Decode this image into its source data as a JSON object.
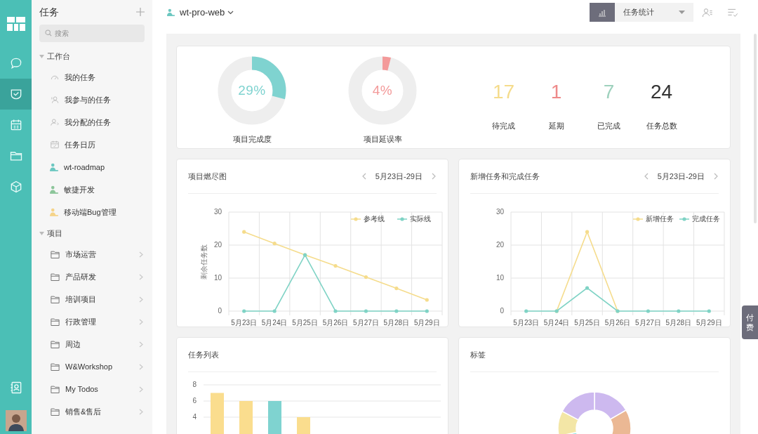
{
  "rail": {
    "items": [
      {
        "kind": "chat",
        "selected": false
      },
      {
        "kind": "tasks",
        "selected": true
      },
      {
        "kind": "calendar",
        "selected": false
      },
      {
        "kind": "folder",
        "selected": false
      },
      {
        "kind": "cube",
        "selected": false
      }
    ]
  },
  "sidebar": {
    "title": "任务",
    "search": {
      "placeholder": "搜索"
    },
    "groups": [
      {
        "label": "工作台",
        "expanded": true,
        "items": [
          {
            "kind": "gauge",
            "label": "我的任务"
          },
          {
            "kind": "users",
            "label": "我参与的任务"
          },
          {
            "kind": "assign",
            "label": "我分配的任务"
          },
          {
            "kind": "calendar",
            "label": "任务日历"
          },
          {
            "kind": "project",
            "label": "wt-roadmap",
            "color": "#6cc7c0"
          },
          {
            "kind": "project",
            "label": "敏捷开发",
            "color": "#8cc59a"
          },
          {
            "kind": "project",
            "label": "移动端Bug管理",
            "color": "#f5d48a"
          }
        ]
      },
      {
        "label": "项目",
        "expanded": true,
        "items": [
          {
            "kind": "folder",
            "label": "市场运营"
          },
          {
            "kind": "folder",
            "label": "产品研发"
          },
          {
            "kind": "folder",
            "label": "培训项目"
          },
          {
            "kind": "folder",
            "label": "行政管理"
          },
          {
            "kind": "folder",
            "label": "周边"
          },
          {
            "kind": "folder",
            "label": "W&Workshop"
          },
          {
            "kind": "folder",
            "label": "My Todos"
          },
          {
            "kind": "folder",
            "label": "销售&售后"
          }
        ]
      }
    ]
  },
  "header": {
    "project": "wt-pro-web",
    "view_select": "任务统计"
  },
  "summary": {
    "rings": [
      {
        "value": "29%",
        "label": "项目完成度",
        "level": 0.29,
        "color": "#7fd3d0"
      },
      {
        "value": "4%",
        "label": "项目延误率",
        "level": 0.04,
        "color": "#f39a9a"
      }
    ],
    "stats": [
      {
        "value": "17",
        "label": "待完成",
        "color": "#f5dc8c"
      },
      {
        "value": "1",
        "label": "延期",
        "color": "#ee8a8a"
      },
      {
        "value": "7",
        "label": "已完成",
        "color": "#9ed1bd"
      },
      {
        "value": "24",
        "label": "任务总数",
        "color": "#333333"
      }
    ]
  },
  "charts": [
    {
      "title": "项目燃尽图",
      "range": "5月23日-29日",
      "chart_data": {
        "type": "line",
        "ylabel": "剩余任务数",
        "categories": [
          "5月23日",
          "5月24日",
          "5月25日",
          "5月26日",
          "5月27日",
          "5月28日",
          "5月29日"
        ],
        "ylim": [
          0,
          30
        ],
        "yticks": [
          0,
          10,
          20,
          30
        ],
        "legend": true,
        "series": [
          {
            "name": "参考线",
            "color": "#f5dc8c",
            "values": [
              24,
              20.5,
              17,
              13.7,
              10.3,
              6.9,
              3.4
            ]
          },
          {
            "name": "实际线",
            "color": "#7fd3c5",
            "values": [
              0,
              0,
              17,
              0,
              0,
              0,
              0
            ]
          }
        ]
      }
    },
    {
      "title": "新增任务和完成任务",
      "range": "5月23日-29日",
      "chart_data": {
        "type": "line",
        "categories": [
          "5月23日",
          "5月24日",
          "5月25日",
          "5月26日",
          "5月27日",
          "5月28日",
          "5月29日"
        ],
        "ylim": [
          0,
          30
        ],
        "yticks": [
          0,
          10,
          20,
          30
        ],
        "legend": true,
        "series": [
          {
            "name": "新增任务",
            "color": "#f5dc8c",
            "values": [
              null,
              0,
              24,
              0,
              null,
              null,
              null
            ]
          },
          {
            "name": "完成任务",
            "color": "#7fd3c5",
            "values": [
              0,
              0,
              7,
              0,
              0,
              0,
              0
            ]
          }
        ]
      }
    }
  ],
  "task_list": {
    "title": "任务列表",
    "chart_data": {
      "type": "bar",
      "grid": true,
      "ylim": [
        0,
        8
      ],
      "yticks": [
        4,
        6,
        8
      ],
      "values": [
        7,
        6,
        6,
        4
      ],
      "colors": [
        "#fadd8e",
        "#fadd8e",
        "#7fd3d0",
        "#fadd8e"
      ]
    }
  },
  "tags": {
    "title": "标签"
  },
  "pay_tab": "付费"
}
